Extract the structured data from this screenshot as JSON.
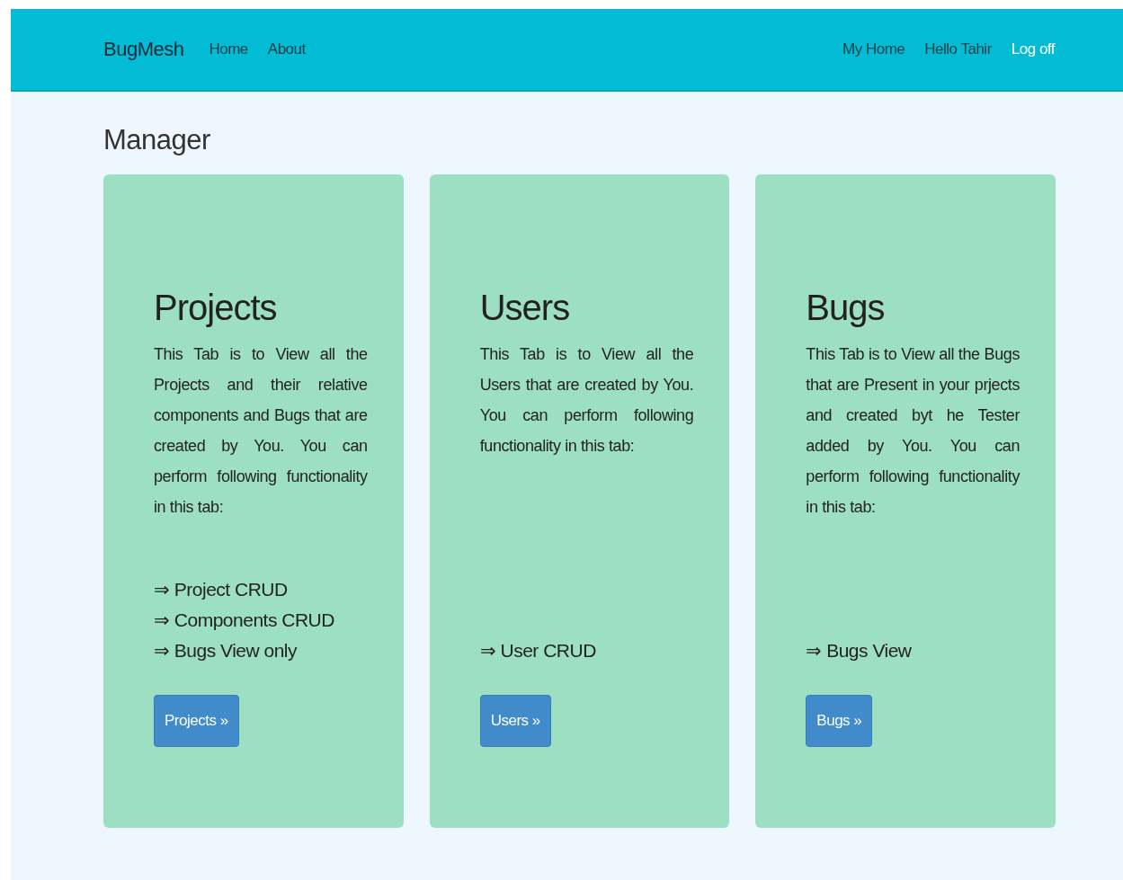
{
  "navbar": {
    "brand": "BugMesh",
    "left_links": [
      {
        "label": "Home",
        "selected": false
      },
      {
        "label": "About",
        "selected": false
      }
    ],
    "right_links": [
      {
        "label": "My Home",
        "selected": false
      },
      {
        "label": "Hello Tahir",
        "selected": false
      },
      {
        "label": "Log off",
        "selected": true
      }
    ]
  },
  "heading": "Manager",
  "cards": [
    {
      "title": "Projects",
      "description": "This Tab is to View all the Projects and their relative components and Bugs that are created by You. You can perform following functionality in this tab:",
      "features": [
        "⇒ Project CRUD",
        "⇒ Components CRUD",
        "⇒ Bugs View only"
      ],
      "button": "Projects »"
    },
    {
      "title": "Users",
      "description": "This Tab is to View all the Users that are created by You. You can perform following functionality in this tab:",
      "features": [
        "⇒ User CRUD"
      ],
      "button": "Users »"
    },
    {
      "title": "Bugs",
      "description": "This Tab is to View all the Bugs that are Present in your prjects and created byt he Tester added by You. You can perform following functionality in this tab:",
      "features": [
        "⇒ Bugs View"
      ],
      "button": "Bugs »"
    }
  ]
}
